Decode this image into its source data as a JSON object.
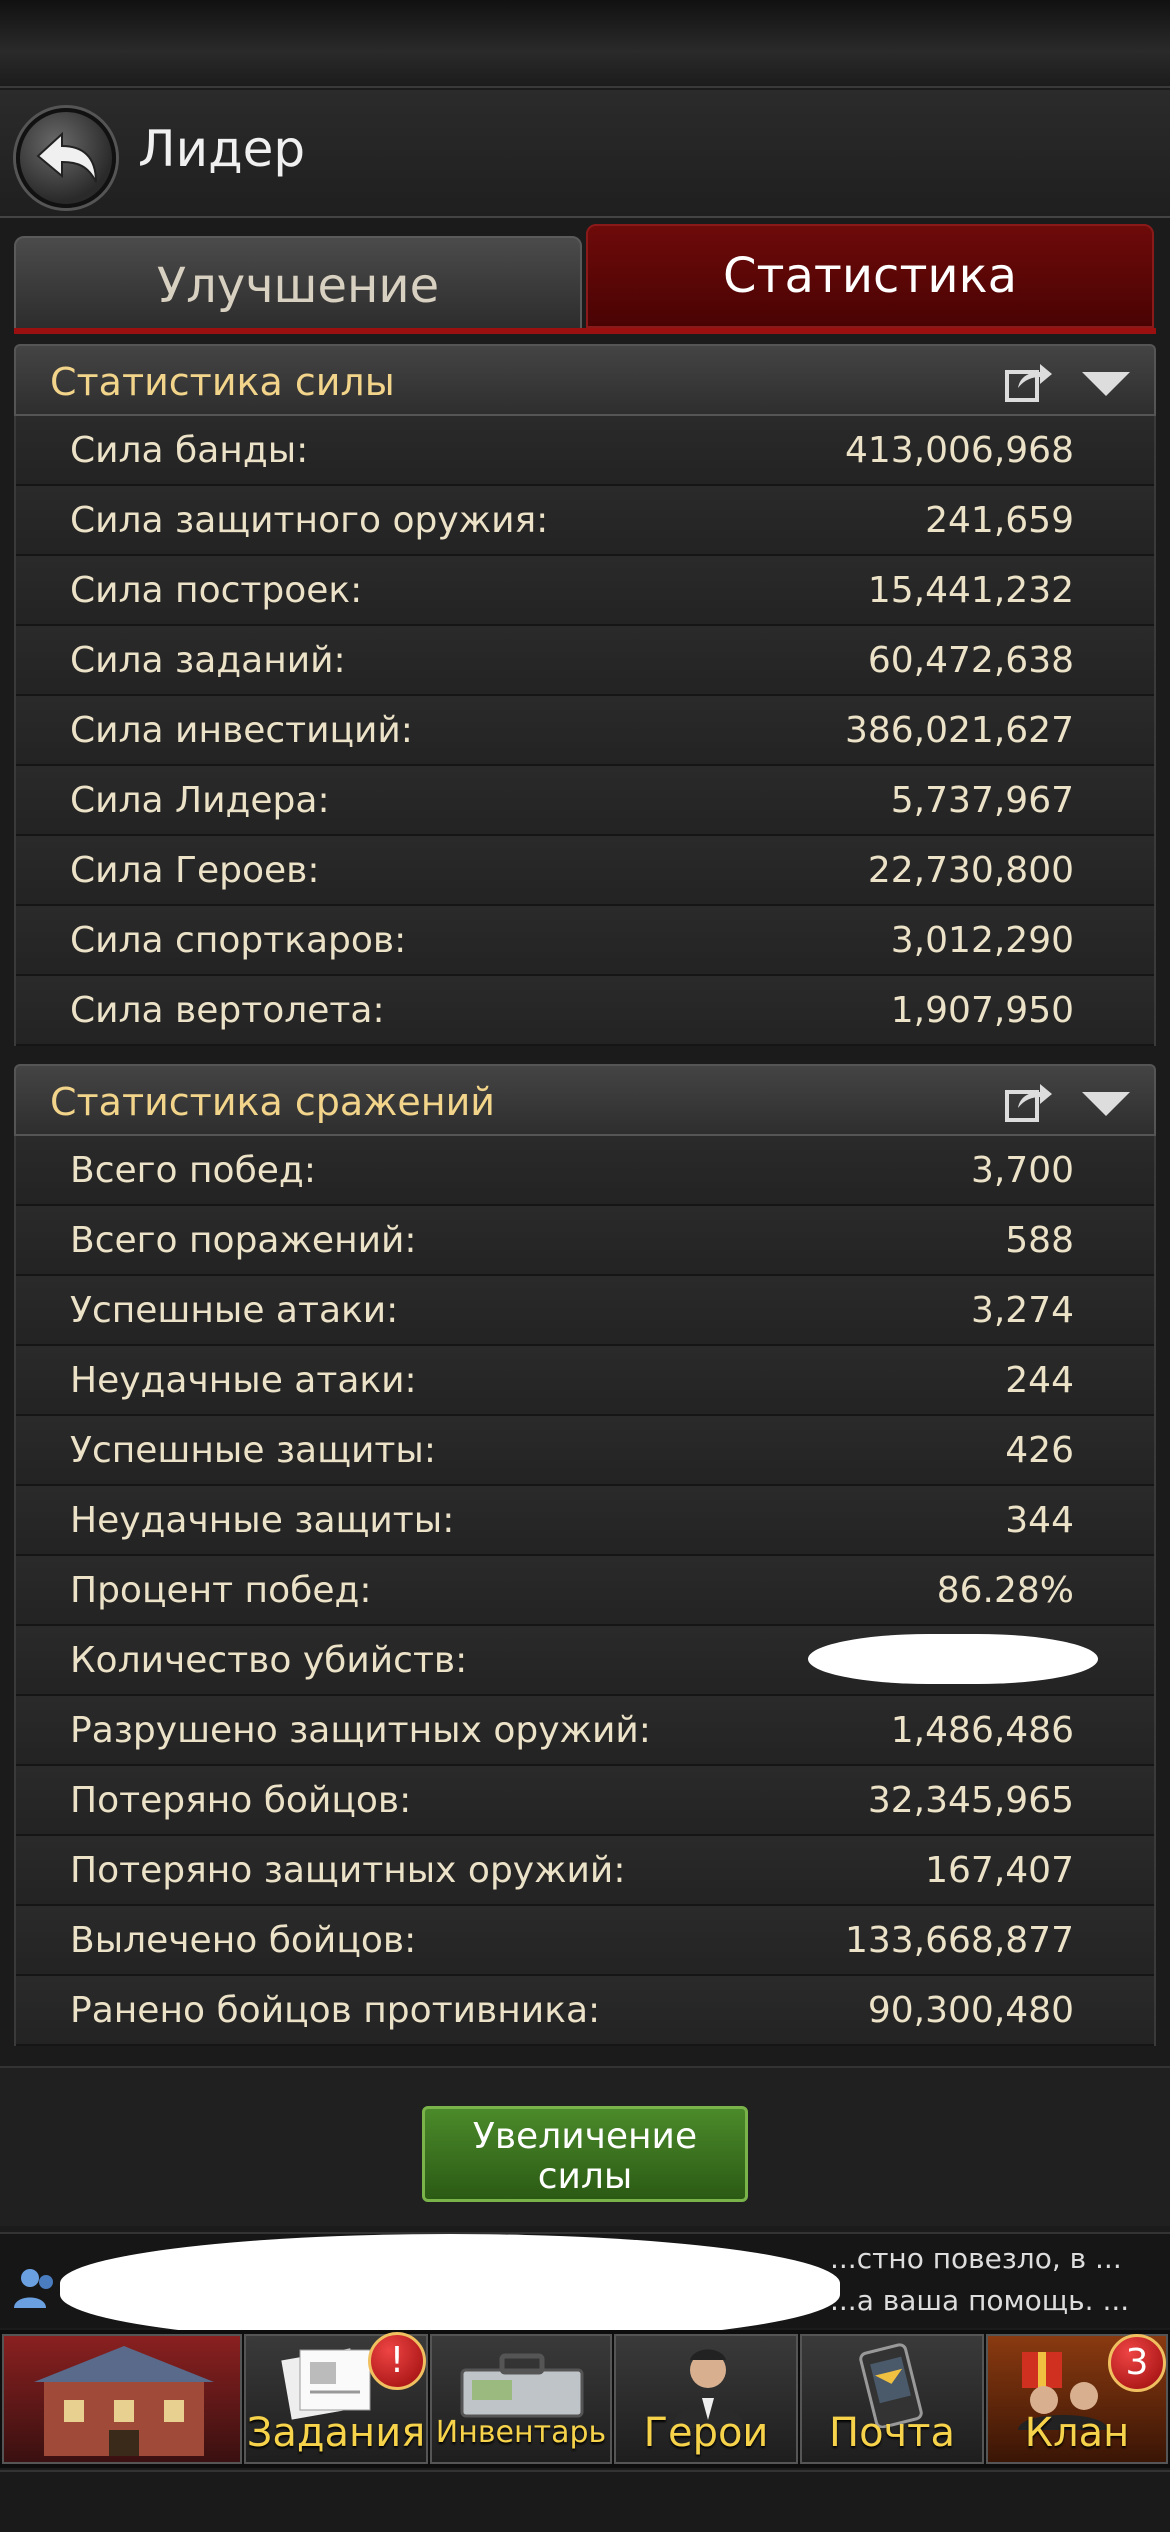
{
  "header": {
    "title": "Лидер"
  },
  "tabs": [
    {
      "label": "Улучшение",
      "active": false
    },
    {
      "label": "Статистика",
      "active": true
    }
  ],
  "power_section": {
    "title": "Статистика силы",
    "rows": [
      {
        "label": "Сила банды:",
        "value": "413,006,968"
      },
      {
        "label": "Сила защитного оружия:",
        "value": "241,659"
      },
      {
        "label": "Сила построек:",
        "value": "15,441,232"
      },
      {
        "label": "Сила заданий:",
        "value": "60,472,638"
      },
      {
        "label": "Сила инвестиций:",
        "value": "386,021,627"
      },
      {
        "label": "Сила Лидера:",
        "value": "5,737,967"
      },
      {
        "label": "Сила Героев:",
        "value": "22,730,800"
      },
      {
        "label": "Сила спорткаров:",
        "value": "3,012,290"
      },
      {
        "label": "Сила вертолета:",
        "value": "1,907,950"
      }
    ]
  },
  "battle_section": {
    "title": "Статистика сражений",
    "rows": [
      {
        "label": "Всего побед:",
        "value": "3,700"
      },
      {
        "label": "Всего поражений:",
        "value": "588"
      },
      {
        "label": "Успешные атаки:",
        "value": "3,274"
      },
      {
        "label": "Неудачные атаки:",
        "value": "244"
      },
      {
        "label": "Успешные защиты:",
        "value": "426"
      },
      {
        "label": "Неудачные защиты:",
        "value": "344"
      },
      {
        "label": "Процент побед:",
        "value": "86.28%"
      },
      {
        "label": "Количество убийств:",
        "value": ""
      },
      {
        "label": "Разрушено защитных оружий:",
        "value": "1,486,486"
      },
      {
        "label": "Потеряно бойцов:",
        "value": "32,345,965"
      },
      {
        "label": "Потеряно защитных оружий:",
        "value": "167,407"
      },
      {
        "label": "Вылечено бойцов:",
        "value": "133,668,877"
      },
      {
        "label": "Ранено бойцов противника:",
        "value": "90,300,480"
      }
    ]
  },
  "power_button": {
    "label_line1": "Увеличение",
    "label_line2": "силы"
  },
  "chat": {
    "line1": "...стно повезло, в ...",
    "line2": "...а ваша помощь. ..."
  },
  "nav": {
    "items": [
      {
        "label": "",
        "icon": "base-building-icon"
      },
      {
        "label": "Задания",
        "icon": "tasks-icon",
        "badge": "!"
      },
      {
        "label": "Инвентарь",
        "icon": "inventory-icon"
      },
      {
        "label": "Герои",
        "icon": "heroes-icon"
      },
      {
        "label": "Почта",
        "icon": "mail-icon"
      },
      {
        "label": "Клан",
        "icon": "clan-icon",
        "badge": "3"
      }
    ]
  },
  "colors": {
    "accent_red": "#9a1010",
    "section_title": "#f2d58a",
    "nav_label": "#f6d34a",
    "button_green": "#4b8a2a"
  }
}
